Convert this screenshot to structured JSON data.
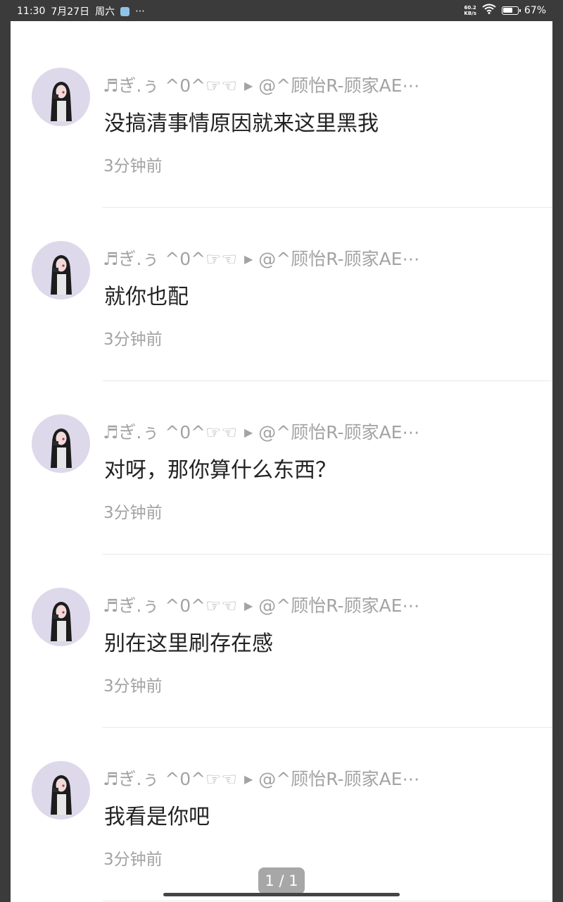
{
  "status_bar": {
    "time": "11:30",
    "date": "7月27日",
    "weekday": "周六",
    "more": "⋯",
    "net_speed_value": "60.2",
    "net_speed_unit": "KB/s",
    "battery_percent": "67%",
    "battery_level": 0.67
  },
  "comments": [
    {
      "author": "♬ぎ.ぅ ^0^☞☜",
      "arrow": "▶",
      "reply_to": "@^顾怡R-顾家AE⋯",
      "text": "没搞清事情原因就来这里黑我",
      "time": "3分钟前"
    },
    {
      "author": "♬ぎ.ぅ ^0^☞☜",
      "arrow": "▶",
      "reply_to": "@^顾怡R-顾家AE⋯",
      "text": "就你也配",
      "time": "3分钟前"
    },
    {
      "author": "♬ぎ.ぅ ^0^☞☜",
      "arrow": "▶",
      "reply_to": "@^顾怡R-顾家AE⋯",
      "text": "对呀，那你算什么东西？",
      "time": "3分钟前"
    },
    {
      "author": "♬ぎ.ぅ ^0^☞☜",
      "arrow": "▶",
      "reply_to": "@^顾怡R-顾家AE⋯",
      "text": "别在这里刷存在感",
      "time": "3分钟前"
    },
    {
      "author": "♬ぎ.ぅ ^0^☞☜",
      "arrow": "▶",
      "reply_to": "@^顾怡R-顾家AE⋯",
      "text": "我看是你吧",
      "time": "3分钟前"
    }
  ],
  "page_indicator": "1 / 1"
}
